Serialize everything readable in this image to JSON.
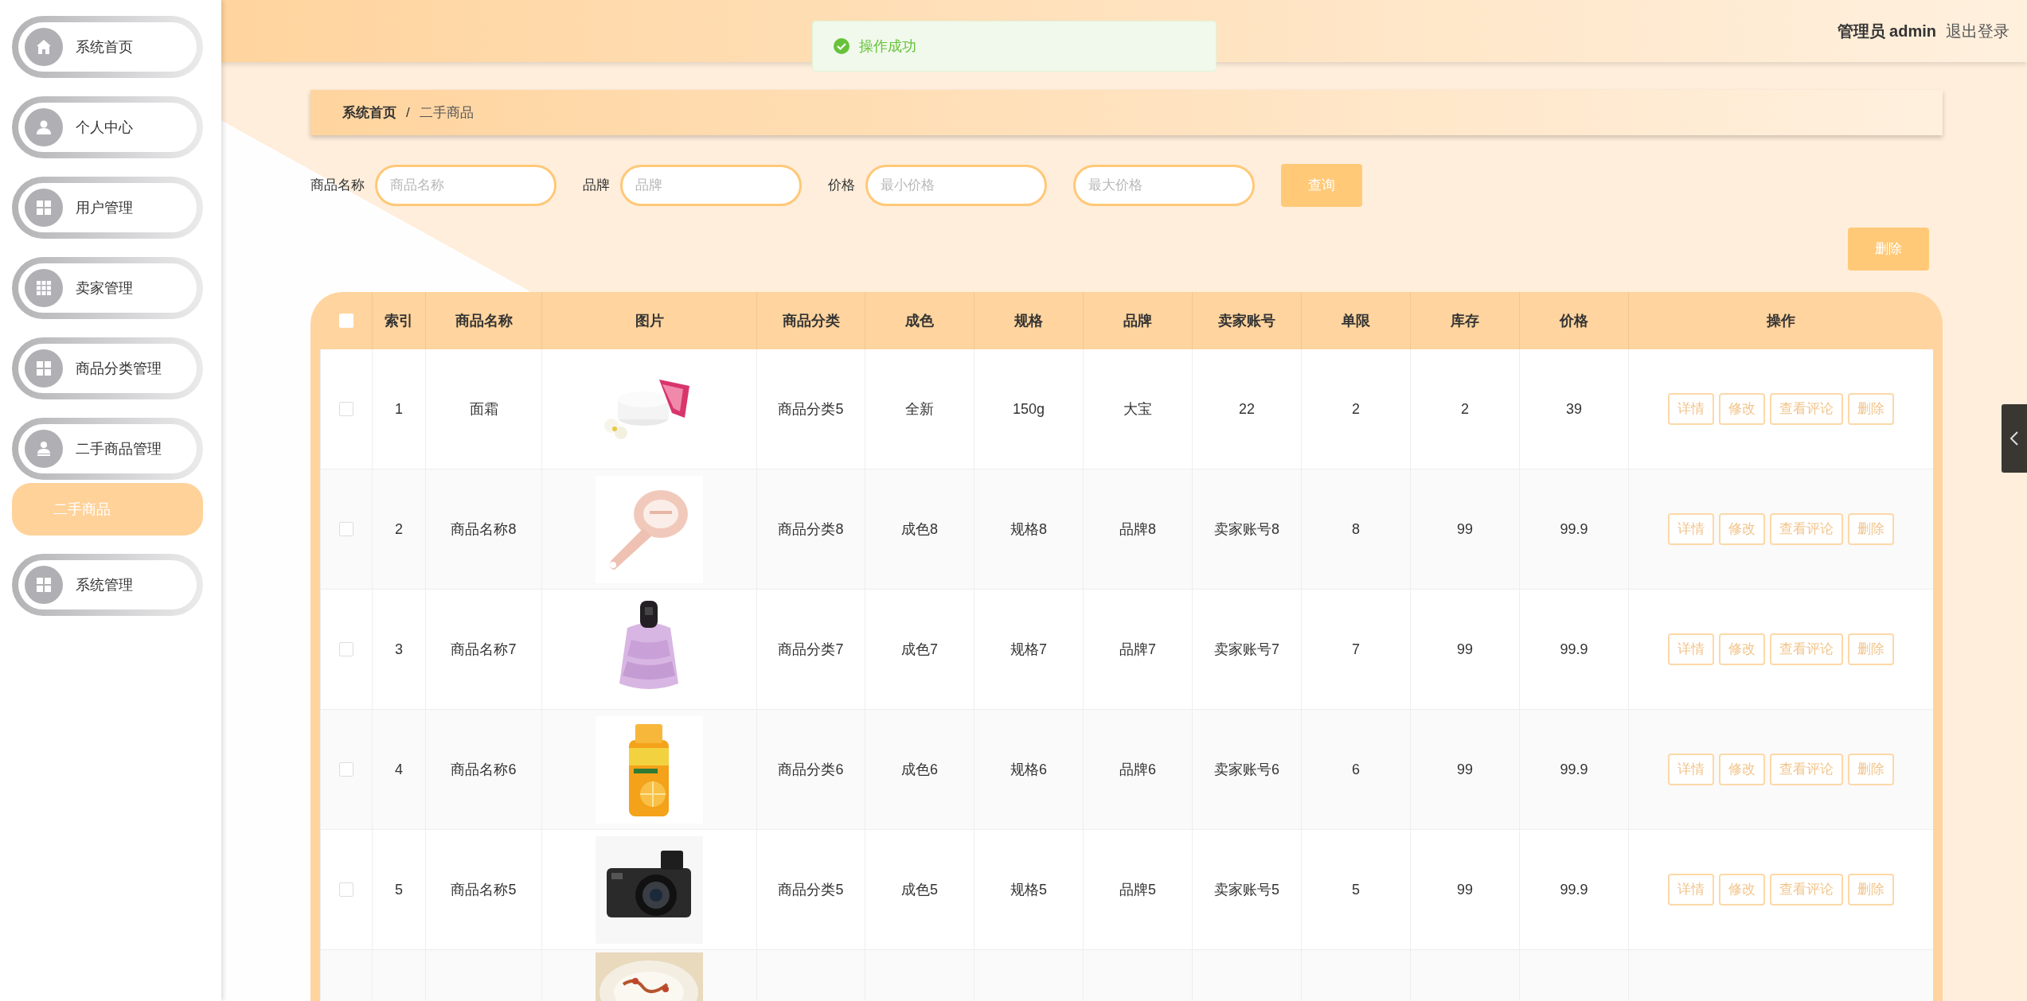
{
  "sidebar": {
    "items": [
      {
        "label": "系统首页",
        "selected": false
      },
      {
        "label": "个人中心",
        "selected": false
      },
      {
        "label": "用户管理",
        "selected": false
      },
      {
        "label": "卖家管理",
        "selected": false
      },
      {
        "label": "商品分类管理",
        "selected": false
      },
      {
        "label": "二手商品管理",
        "selected": false,
        "children": [
          {
            "label": "二手商品",
            "selected": true
          }
        ]
      },
      {
        "label": "系统管理",
        "selected": false
      }
    ]
  },
  "toast": {
    "message": "操作成功"
  },
  "header": {
    "user": "管理员 admin",
    "logout": "退出登录"
  },
  "breadcrumb": [
    "系统首页",
    "二手商品"
  ],
  "breadcrumb_separator": "/",
  "filters": [
    {
      "label": "商品名称",
      "placeholder": "商品名称"
    },
    {
      "label": "品牌",
      "placeholder": "品牌"
    },
    {
      "label": "价格",
      "placeholder": "最小价格"
    },
    {
      "placeholder": "最大价格"
    }
  ],
  "search_button": "查询",
  "delete_button": "删除",
  "table": {
    "select_all": false,
    "columns": [
      "索引",
      "商品名称",
      "图片",
      "商品分类",
      "成色",
      "规格",
      "品牌",
      "卖家账号",
      "单限",
      "库存",
      "价格",
      "操作"
    ],
    "rows": [
      {
        "kind": "full",
        "checked": false,
        "cells": [
          "1",
          "面霜",
          "商品分类5",
          "全新",
          "150g",
          "大宝",
          "22",
          "2",
          "2",
          "39"
        ],
        "actions": [
          "详情",
          "修改",
          "查看评论",
          "删除"
        ]
      },
      {
        "kind": "full",
        "checked": false,
        "cells": [
          "2",
          "商品名称8",
          "商品分类8",
          "成色8",
          "规格8",
          "品牌8",
          "卖家账号8",
          "8",
          "99",
          "99.9"
        ],
        "actions": [
          "详情",
          "修改",
          "查看评论",
          "删除"
        ]
      },
      {
        "kind": "full",
        "checked": false,
        "cells": [
          "3",
          "商品名称7",
          "商品分类7",
          "成色7",
          "规格7",
          "品牌7",
          "卖家账号7",
          "7",
          "99",
          "99.9"
        ],
        "actions": [
          "详情",
          "修改",
          "查看评论",
          "删除"
        ]
      },
      {
        "kind": "full",
        "checked": false,
        "cells": [
          "4",
          "商品名称6",
          "商品分类6",
          "成色6",
          "规格6",
          "品牌6",
          "卖家账号6",
          "6",
          "99",
          "99.9"
        ],
        "actions": [
          "详情",
          "修改",
          "查看评论",
          "删除"
        ]
      },
      {
        "kind": "full",
        "checked": false,
        "cells": [
          "5",
          "商品名称5",
          "商品分类5",
          "成色5",
          "规格5",
          "品牌5",
          "卖家账号5",
          "5",
          "99",
          "99.9"
        ],
        "actions": [
          "详情",
          "修改",
          "查看评论",
          "删除"
        ]
      },
      {
        "kind": "partial"
      }
    ]
  }
}
